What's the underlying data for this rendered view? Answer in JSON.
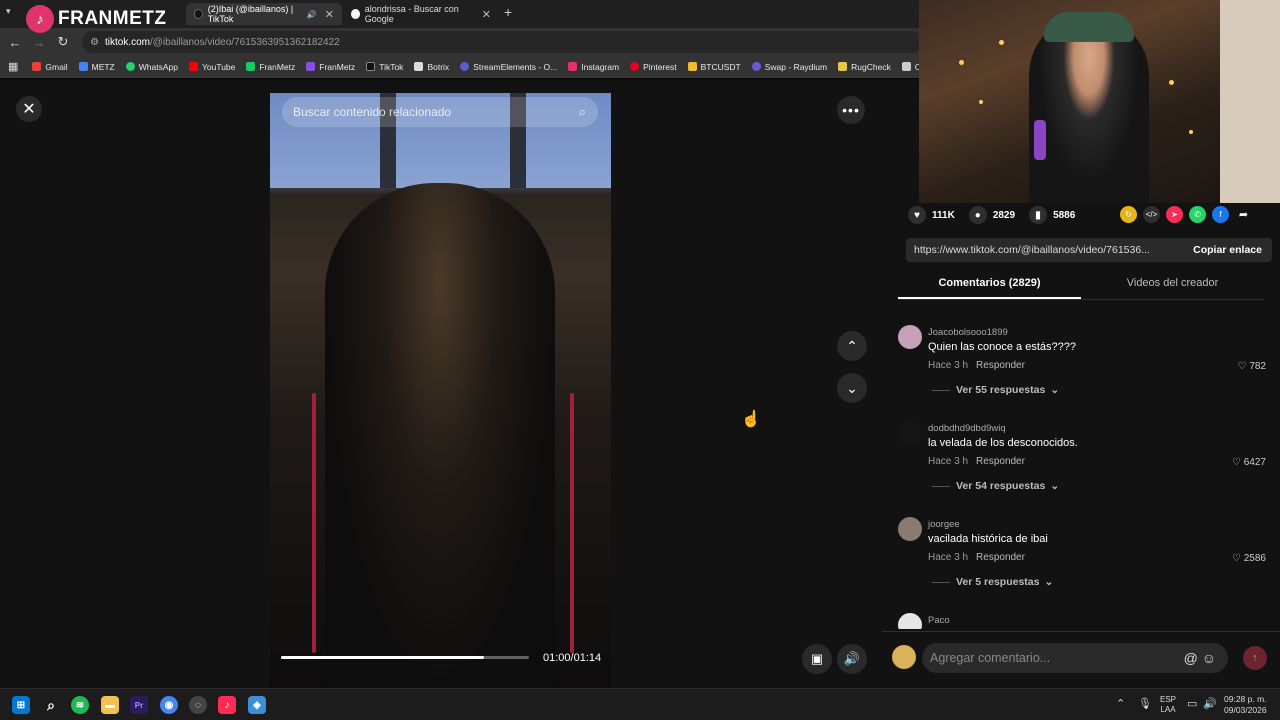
{
  "browser": {
    "tabs": [
      {
        "title": "(2)Ibai (@ibaillanos) | TikTok",
        "audio": "🔊"
      },
      {
        "title": "alondrissa - Buscar con Google"
      }
    ],
    "overlay_logo": {
      "text": "FRANMETZ",
      "icon": "tiktok-icon"
    },
    "new_tab": "+",
    "url_host": "tiktok.com",
    "url_path": "/@ibaillanos/video/7615363951362182422",
    "bookmarks": [
      "Gmail",
      "METZ",
      "WhatsApp",
      "YouTube",
      "FranMetz",
      "FranMetz",
      "TikTok",
      "Botrix",
      "StreamElements - O...",
      "Instagram",
      "Pinterest",
      "BTCUSDT",
      "Swap - Raydium",
      "RugCheck",
      "Crypt"
    ]
  },
  "video": {
    "search_placeholder": "Buscar contenido relacionado",
    "time": "01:00/01:14",
    "progress": 0.82
  },
  "panel": {
    "likes": "111K",
    "comments_count": "2829",
    "saves": "5886",
    "link": "https://www.tiktok.com/@ibaillanos/video/761536...",
    "copy_label": "Copiar enlace",
    "tabs": [
      "Comentarios (2829)",
      "Videos del creador"
    ],
    "comments": [
      {
        "user": "Joacobolsooo1899",
        "text": "Quien las conoce a estás????",
        "time": "Hace 3 h",
        "reply": "Responder",
        "likes": "782",
        "replies": "Ver 55 respuestas"
      },
      {
        "user": "dodbdhd9dbd9wiq",
        "text": "la velada de los desconocidos.",
        "time": "Hace 3 h",
        "reply": "Responder",
        "likes": "6427",
        "replies": "Ver 54 respuestas"
      },
      {
        "user": "joorgee",
        "text": "vacilada histórica de ibai",
        "time": "Hace 3 h",
        "reply": "Responder",
        "likes": "2586",
        "replies": "Ver 5 respuestas"
      },
      {
        "user": "Paco",
        "text": "",
        "time": "",
        "reply": "",
        "likes": "",
        "replies": ""
      }
    ],
    "comment_placeholder": "Agregar comentario..."
  },
  "taskbar": {
    "lang_top": "ESP",
    "lang_bottom": "LAA",
    "time": "09:28 p. m.",
    "date": "09/03/2026"
  }
}
